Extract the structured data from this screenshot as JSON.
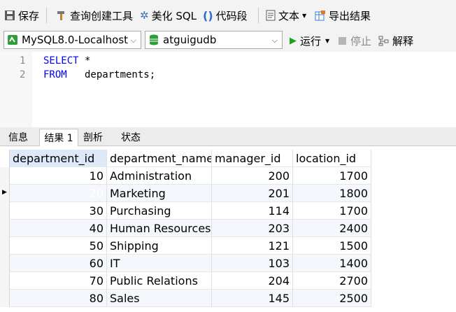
{
  "toolbar": {
    "save": "保存",
    "query_builder": "查询创建工具",
    "beautify_sql": "美化 SQL",
    "code_snippet": "代码段",
    "text": "文本",
    "export_results": "导出结果"
  },
  "connection_bar": {
    "connection": "MySQL8.0-Localhost",
    "database": "atguigudb",
    "run": "运行",
    "stop": "停止",
    "explain": "解释"
  },
  "editor": {
    "lines": [
      {
        "number": "1",
        "keyword": "SELECT",
        "rest": " *"
      },
      {
        "number": "2",
        "keyword": "FROM",
        "rest": "   departments;"
      }
    ]
  },
  "result_tabs": [
    "信息",
    "结果 1",
    "剖析",
    "状态"
  ],
  "active_tab": 1,
  "table": {
    "columns": [
      "department_id",
      "department_name",
      "manager_id",
      "location_id"
    ],
    "rows": [
      [
        "10",
        "Administration",
        "200",
        "1700"
      ],
      [
        "20",
        "Marketing",
        "201",
        "1800"
      ],
      [
        "30",
        "Purchasing",
        "114",
        "1700"
      ],
      [
        "40",
        "Human Resources",
        "203",
        "2400"
      ],
      [
        "50",
        "Shipping",
        "121",
        "1500"
      ],
      [
        "60",
        "IT",
        "103",
        "1400"
      ],
      [
        "70",
        "Public Relations",
        "204",
        "2700"
      ],
      [
        "80",
        "Sales",
        "145",
        "2500"
      ]
    ],
    "selected_row": 1
  },
  "colors": {
    "selection": "#0a79d8",
    "keyword": "#0000ff",
    "run_icon": "#1aa21a"
  }
}
